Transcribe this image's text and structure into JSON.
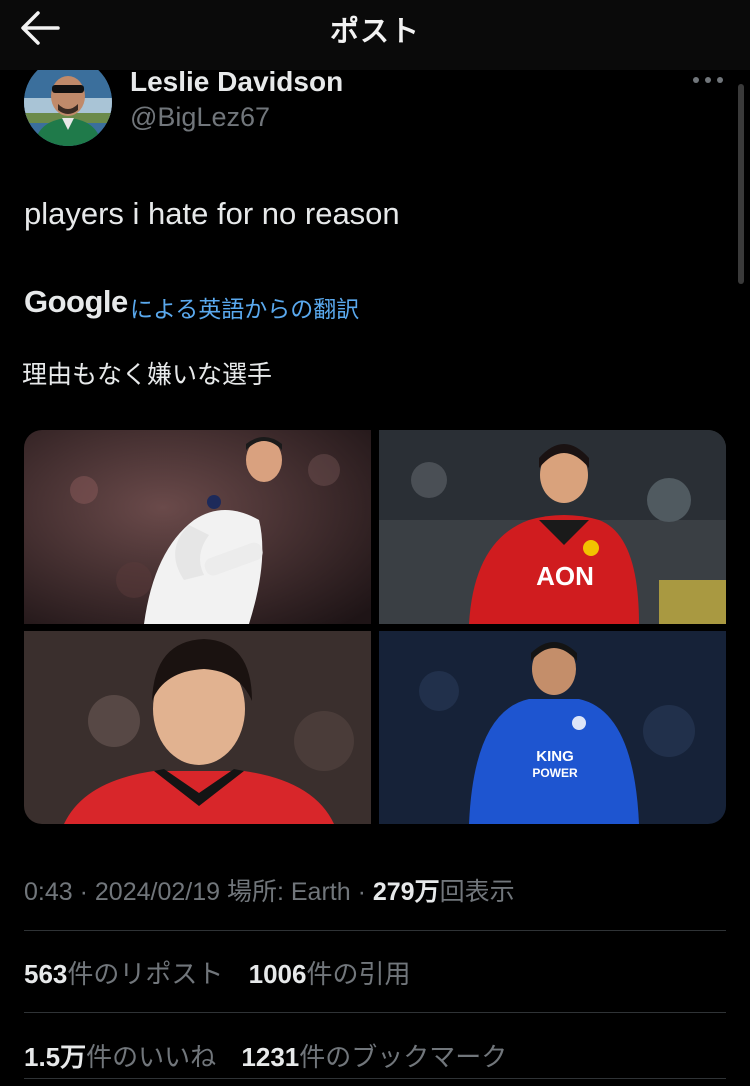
{
  "header": {
    "title": "ポスト",
    "back_icon": "arrow-left-icon"
  },
  "author": {
    "name": "Leslie Davidson",
    "handle": "@BigLez67"
  },
  "tweet": {
    "text": "players i hate for no reason"
  },
  "translation": {
    "provider": "Google",
    "label": "による英語からの翻訳",
    "text": "理由もなく嫌いな選手"
  },
  "media": {
    "kit_text_1": "AON",
    "kit_text_2": "KING",
    "kit_text_3": "POWER"
  },
  "meta": {
    "time": "0:43",
    "sep1": "·",
    "date": "2024/02/19",
    "location_label": "場所: Earth",
    "sep2": "·",
    "views_num": "279",
    "views_unit": "万",
    "views_label": "回表示"
  },
  "stats": {
    "reposts_num": "563",
    "reposts_label": "件のリポスト",
    "quotes_num": "1006",
    "quotes_label": "件の引用",
    "likes_num": "1.5",
    "likes_unit": "万",
    "likes_label": "件のいいね",
    "bookmarks_num": "1231",
    "bookmarks_label": "件のブックマーク"
  },
  "colors": {
    "background": "#000000",
    "text": "#e7e9ea",
    "muted": "#71767b",
    "link": "#5aa9ee",
    "divider": "#2f3336"
  }
}
